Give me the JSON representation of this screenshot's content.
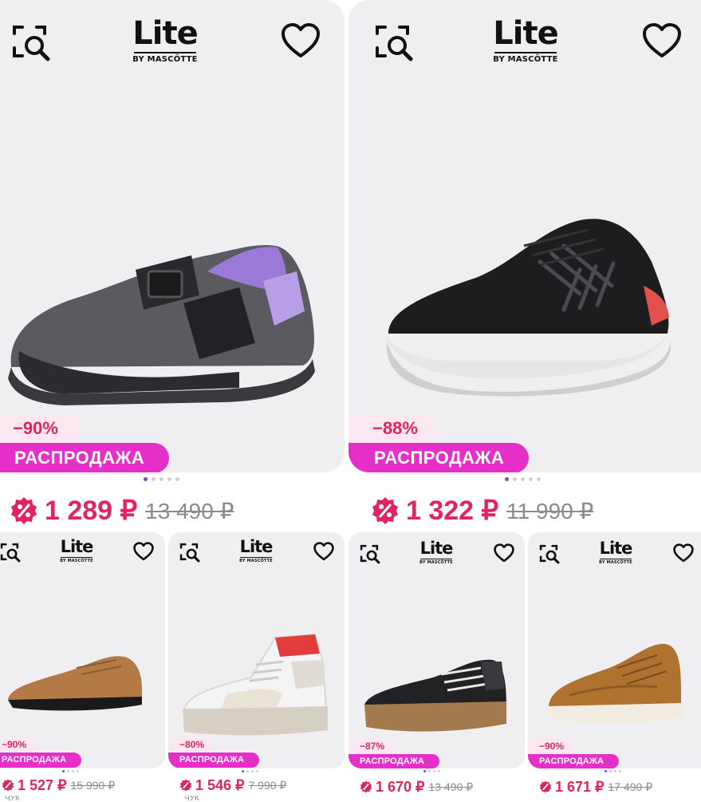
{
  "brand": {
    "word": "Lite",
    "sub": "BY MASCÖTTE"
  },
  "sale_label": "РАСПРОДАЖА",
  "colors": {
    "price": "#e0245e",
    "sale_bg": "#e62fc9",
    "discount_bg": "#fbe7ef",
    "card_bg": "#efeff1",
    "dot_active": "#8b3fd9"
  },
  "icons": {
    "search": "image-search-icon",
    "favorite": "heart-icon",
    "badge": "discount-badge-icon"
  },
  "products": [
    {
      "discount": "−90%",
      "price": "1 289 ₽",
      "old_price": "13 490 ₽"
    },
    {
      "discount": "−88%",
      "price": "1 322 ₽",
      "old_price": "11 990 ₽"
    },
    {
      "discount": "−90%",
      "price": "1 527 ₽",
      "old_price": "15 990 ₽",
      "meta": "ЧУК"
    },
    {
      "discount": "−80%",
      "price": "1 546 ₽",
      "old_price": "7 990 ₽",
      "meta": "ЧУК"
    },
    {
      "discount": "−87%",
      "price": "1 670 ₽",
      "old_price": "13 490 ₽"
    },
    {
      "discount": "−90%",
      "price": "1 671 ₽",
      "old_price": "17 490 ₽"
    }
  ]
}
